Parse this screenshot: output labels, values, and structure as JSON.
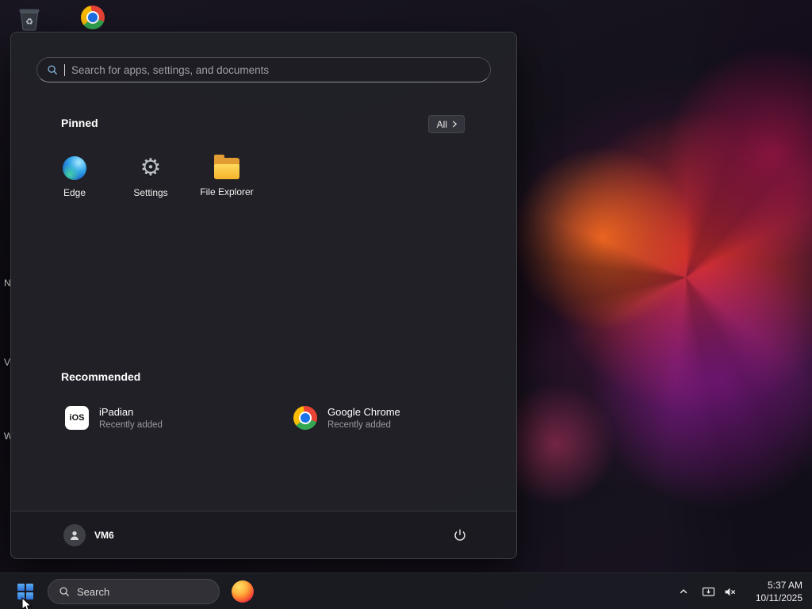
{
  "desktop": {
    "icons": [
      {
        "name": "Recycle Bin"
      },
      {
        "name": "Google Chrome"
      }
    ],
    "edge_labels": [
      "N",
      "V",
      "W"
    ]
  },
  "start_menu": {
    "search": {
      "placeholder": "Search for apps, settings, and documents"
    },
    "pinned": {
      "title": "Pinned",
      "all_button": {
        "label": "All"
      },
      "apps": [
        {
          "label": "Edge"
        },
        {
          "label": "Settings"
        },
        {
          "label": "File Explorer"
        }
      ]
    },
    "recommended": {
      "title": "Recommended",
      "items": [
        {
          "title": "iPadian",
          "subtitle": "Recently added",
          "icon_text": "iOS"
        },
        {
          "title": "Google Chrome",
          "subtitle": "Recently added"
        }
      ]
    },
    "footer": {
      "user_name": "VM6"
    }
  },
  "taskbar": {
    "search": {
      "label": "Search"
    },
    "tray": {
      "time": "5:37 AM",
      "date": "10/11/2025"
    }
  }
}
